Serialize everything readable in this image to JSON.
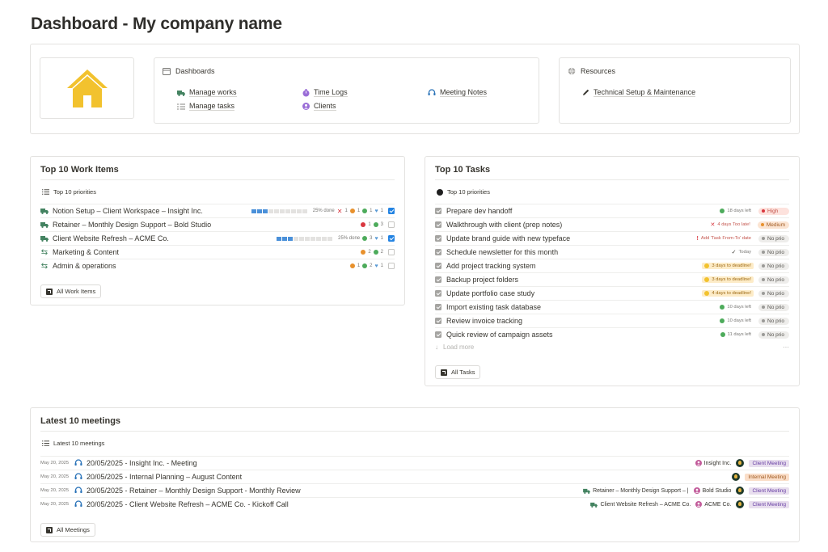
{
  "page": {
    "title": "Dashboard - My company name"
  },
  "nav": {
    "dashboards_label": "Dashboards",
    "links": {
      "manage_works": "Manage works",
      "manage_tasks": "Manage tasks",
      "time_logs": "Time Logs",
      "clients": "Clients",
      "meeting_notes": "Meeting Notes"
    },
    "resources_label": "Resources",
    "resources_links": {
      "tech_setup": "Technical Setup & Maintenance"
    }
  },
  "work_items": {
    "title": "Top 10 Work Items",
    "view_label": "Top 10 priorities",
    "rows": [
      {
        "icon": "truck-icon",
        "title": "Notion Setup – Client Workspace – Insight Inc.",
        "progress_segments": 10,
        "progress_on": 3,
        "progress_label": "25% done",
        "x_count": "1",
        "orange": "1",
        "green": "1",
        "heart": "1",
        "checked": true
      },
      {
        "icon": "truck-icon",
        "title": "Retainer – Monthly Design Support – Bold Studio",
        "red": "1",
        "green": "3",
        "checked": false
      },
      {
        "icon": "truck-icon",
        "title": "Client Website Refresh – ACME Co.",
        "progress_segments": 10,
        "progress_on": 3,
        "progress_label": "25% done",
        "green": "3",
        "heart": "1",
        "checked": true
      },
      {
        "icon": "recycle-icon",
        "title": "Marketing & Content",
        "orange": "2",
        "green": "2",
        "checked": false
      },
      {
        "icon": "recycle-icon",
        "title": "Admin & operations",
        "orange": "1",
        "green": "2",
        "heart": "1",
        "checked": false
      }
    ],
    "button_label": "All Work Items"
  },
  "tasks": {
    "title": "Top 10 Tasks",
    "view_label": "Top 10 priorities",
    "rows": [
      {
        "title": "Prepare dev handoff",
        "due": "18 days left",
        "due_style": "ok",
        "prio": "High",
        "prio_style": "high"
      },
      {
        "title": "Walkthrough with client (prep notes)",
        "due": "4 days Too late!",
        "due_style": "late-x",
        "prio": "Medium",
        "prio_style": "med"
      },
      {
        "title": "Update brand guide with new typeface",
        "due": "Add 'Task From-To' date",
        "due_style": "late",
        "prio": "No prio",
        "prio_style": "none"
      },
      {
        "title": "Schedule newsletter for this month",
        "due": "Today",
        "due_style": "today",
        "prio": "No prio",
        "prio_style": "none"
      },
      {
        "title": "Add project tracking system",
        "due": "3 days to deadline!",
        "due_style": "warn",
        "prio": "No prio",
        "prio_style": "none"
      },
      {
        "title": "Backup project folders",
        "due": "3 days to deadline!",
        "due_style": "warn",
        "prio": "No prio",
        "prio_style": "none"
      },
      {
        "title": "Update portfolio case study",
        "due": "4 days to deadline!",
        "due_style": "warn",
        "prio": "No prio",
        "prio_style": "none"
      },
      {
        "title": "Import existing task database",
        "due": "10 days left",
        "due_style": "ok",
        "prio": "No prio",
        "prio_style": "none"
      },
      {
        "title": "Review invoice tracking",
        "due": "10 days left",
        "due_style": "ok",
        "prio": "No prio",
        "prio_style": "none"
      },
      {
        "title": "Quick review of campaign assets",
        "due": "11 days left",
        "due_style": "ok",
        "prio": "No prio",
        "prio_style": "none"
      }
    ],
    "load_more": "Load more",
    "more_dots": "···",
    "button_label": "All Tasks"
  },
  "meetings": {
    "title": "Latest 10 meetings",
    "view_label": "Latest 10 meetings",
    "rows": [
      {
        "date": "May 20, 2025",
        "title": "20/05/2025 - Insight Inc. - Meeting",
        "work": "",
        "client": "Insight Inc.",
        "tag": "Client Meeting",
        "tag_style": "client"
      },
      {
        "date": "May 20, 2025",
        "title": "20/05/2025 - Internal Planning – August Content",
        "work": "",
        "client": "",
        "tag": "Internal Meeting",
        "tag_style": "internal"
      },
      {
        "date": "May 20, 2025",
        "title": "20/05/2025 - Retainer – Monthly Design Support - Monthly Review",
        "work": "Retainer – Monthly Design Support – |",
        "client": "Bold Studio",
        "tag": "Client Meeting",
        "tag_style": "client"
      },
      {
        "date": "May 20, 2025",
        "title": "20/05/2025 - Client Website Refresh – ACME Co. - Kickoff Call",
        "work": "Client Website Refresh – ACME Co.",
        "client": "ACME Co.",
        "tag": "Client Meeting",
        "tag_style": "client"
      }
    ],
    "button_label": "All Meetings"
  },
  "colors": {
    "truck_green": "#448361",
    "house_yellow": "#f2c22e",
    "progress_blue": "#4a90d9",
    "dot_green": "#4dab5b",
    "dot_orange": "#e8912d",
    "dot_red": "#d9373f",
    "heart_blue": "#5b9bd5",
    "client_purple": "#9a6dd7"
  }
}
